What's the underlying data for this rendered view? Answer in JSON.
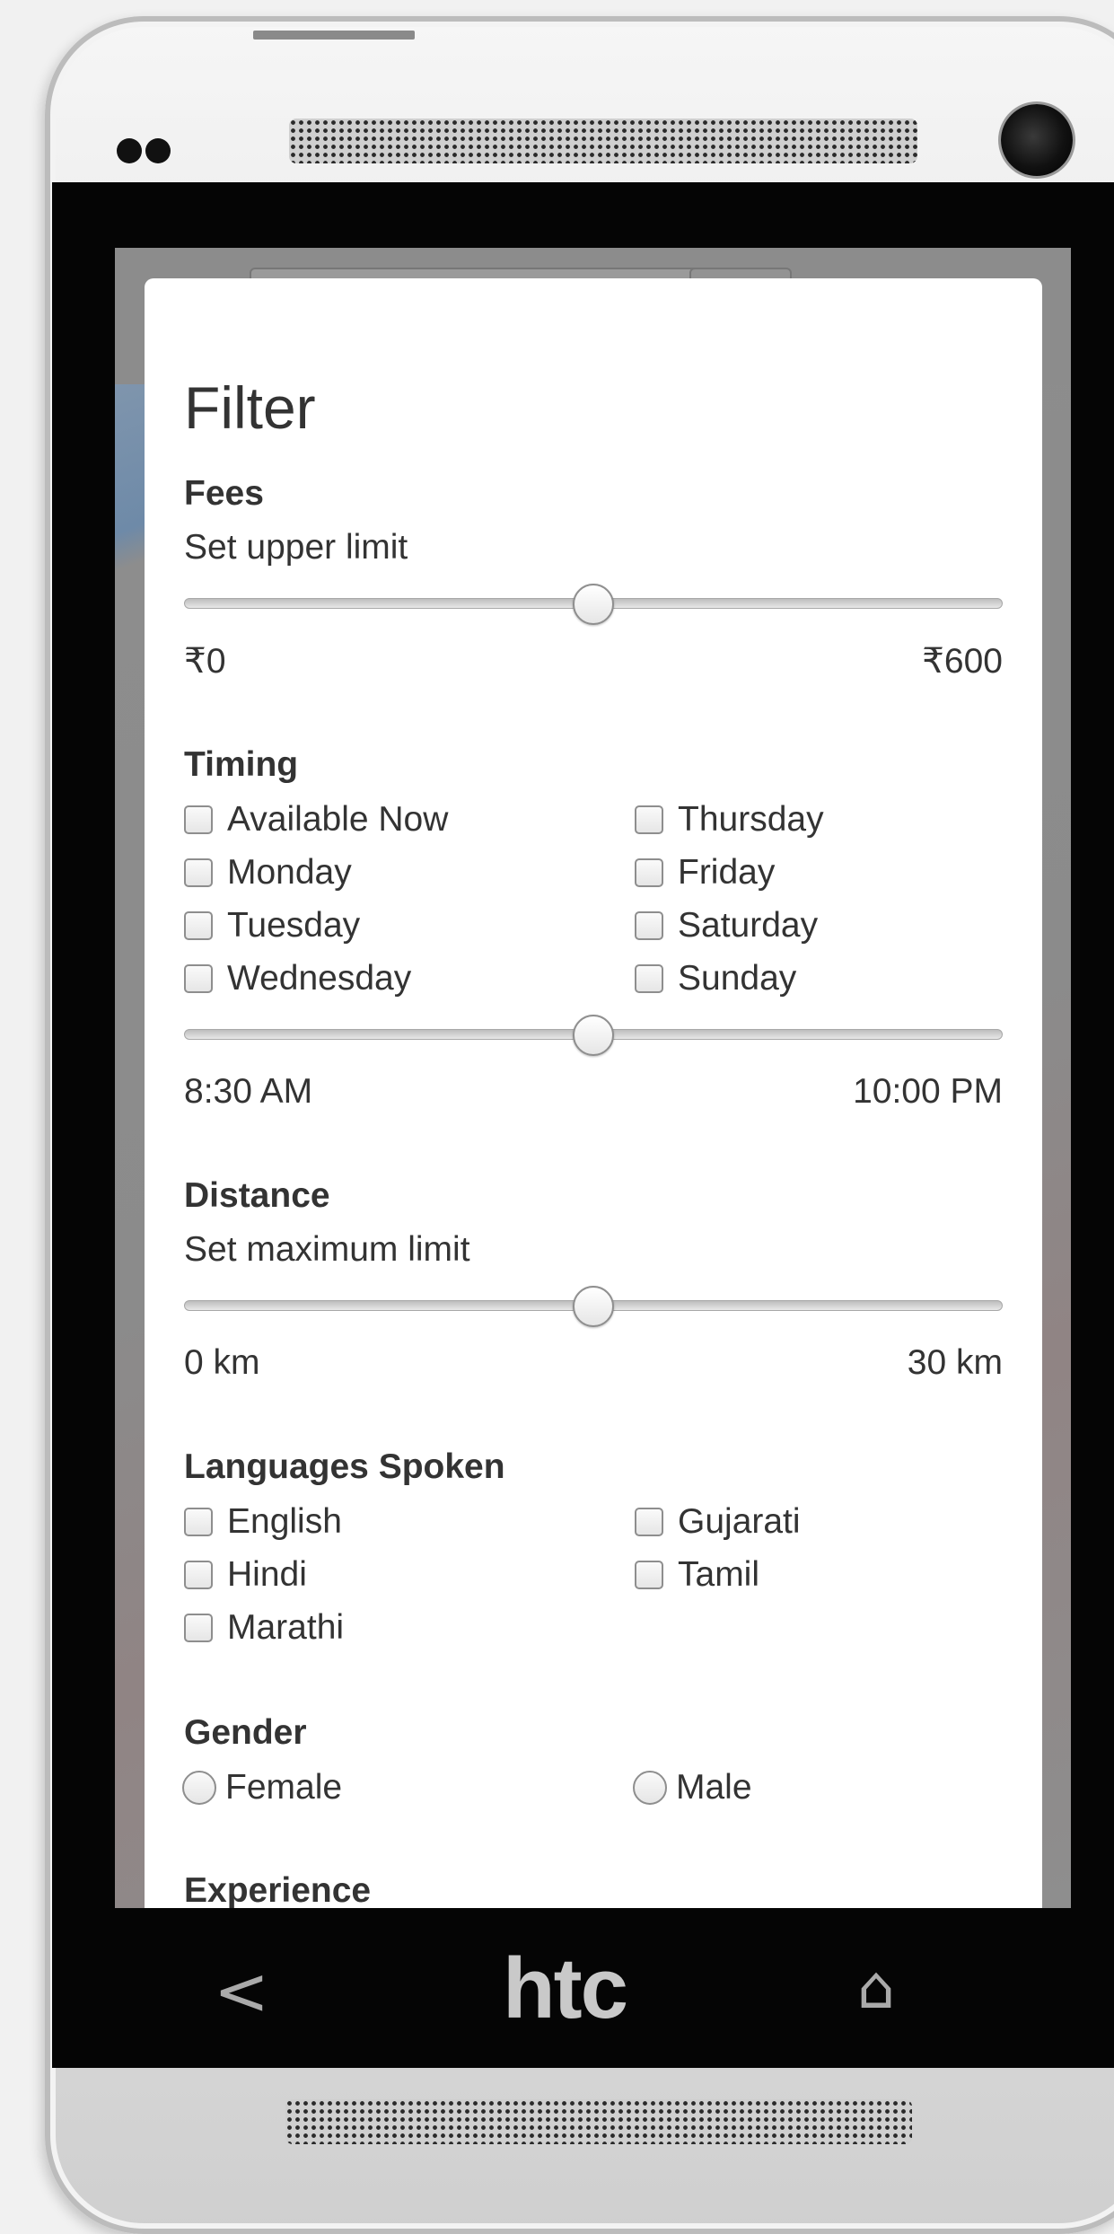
{
  "filter": {
    "title": "Filter",
    "fees": {
      "heading": "Fees",
      "subheading": "Set upper limit",
      "min_label": "₹0",
      "max_label": "₹600",
      "slider_fraction": 0.5
    },
    "timing": {
      "heading": "Timing",
      "options": [
        "Available Now",
        "Thursday",
        "Monday",
        "Friday",
        "Tuesday",
        "Saturday",
        "Wednesday",
        "Sunday"
      ],
      "min_label": "8:30 AM",
      "max_label": "10:00 PM",
      "slider_fraction": 0.5
    },
    "distance": {
      "heading": "Distance",
      "subheading": "Set maximum limit",
      "min_label": "0 km",
      "max_label": "30 km",
      "slider_fraction": 0.5
    },
    "languages": {
      "heading": "Languages Spoken",
      "options": [
        "English",
        "Gujarati",
        "Hindi",
        "Tamil",
        "Marathi"
      ]
    },
    "gender": {
      "heading": "Gender",
      "options": [
        "Female",
        "Male"
      ]
    },
    "experience": {
      "heading": "Experience"
    }
  },
  "device": {
    "nav_back": "<",
    "brand": "htc",
    "nav_home": "⌂"
  },
  "colors": {
    "modal_bg": "#ffffff",
    "text": "#333333",
    "bezel": "#050505",
    "overlay": "#9a9a9a"
  }
}
